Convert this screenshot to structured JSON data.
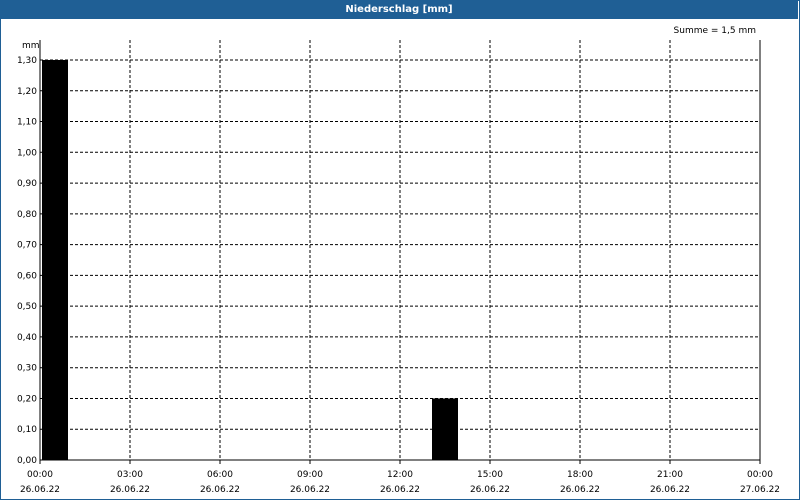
{
  "header": {
    "title": "Niederschlag [mm]"
  },
  "summary": {
    "text": "Summe = 1,5 mm"
  },
  "chart_data": {
    "type": "bar",
    "title": "Niederschlag [mm]",
    "ylabel": "mm",
    "xlabel": "",
    "ylim": [
      0,
      1.3
    ],
    "yticks": [
      "0,00",
      "0,10",
      "0,20",
      "0,30",
      "0,40",
      "0,50",
      "0,60",
      "0,70",
      "0,80",
      "0,90",
      "1,00",
      "1,10",
      "1,20",
      "1,30"
    ],
    "x_ticks": [
      {
        "time": "00:00",
        "date": "26.06.22"
      },
      {
        "time": "03:00",
        "date": "26.06.22"
      },
      {
        "time": "06:00",
        "date": "26.06.22"
      },
      {
        "time": "09:00",
        "date": "26.06.22"
      },
      {
        "time": "12:00",
        "date": "26.06.22"
      },
      {
        "time": "15:00",
        "date": "26.06.22"
      },
      {
        "time": "18:00",
        "date": "26.06.22"
      },
      {
        "time": "21:00",
        "date": "26.06.22"
      },
      {
        "time": "00:00",
        "date": "27.06.22"
      }
    ],
    "bars": [
      {
        "start": "00:00",
        "end": "01:00",
        "value": 1.3
      },
      {
        "start": "13:00",
        "end": "14:00",
        "value": 0.2
      }
    ],
    "grid": true,
    "bar_color": "#000000",
    "sum": 1.5
  }
}
